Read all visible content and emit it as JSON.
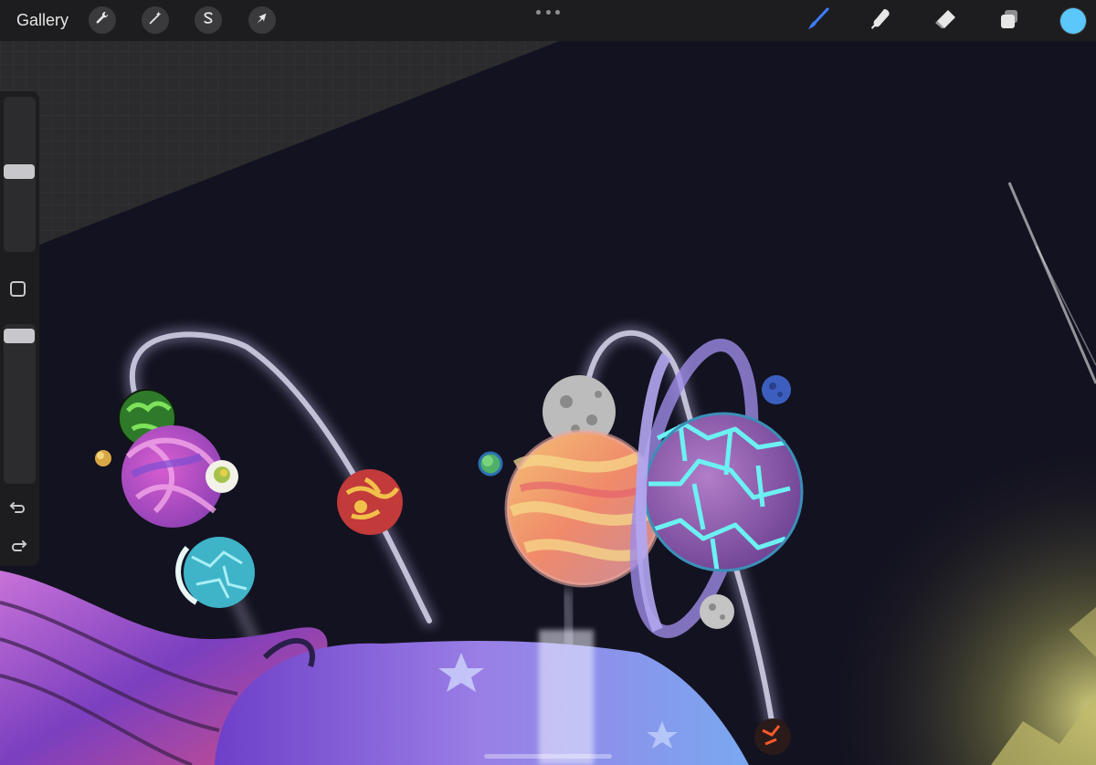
{
  "toolbar": {
    "gallery_label": "Gallery",
    "left_tools": [
      "wrench-icon",
      "magic-wand-icon",
      "selection-s-icon",
      "transform-arrow-icon"
    ],
    "right_tools": [
      "brush-icon",
      "smudge-icon",
      "eraser-icon",
      "layers-icon"
    ],
    "active_tool": "brush",
    "active_tool_color": "#3d7eff",
    "current_color": "#5ac8fa"
  },
  "sidebar": {
    "brush_size_level": 0.45,
    "opacity_level": 1.0,
    "icons": [
      "modify-square-icon",
      "undo-icon",
      "redo-icon"
    ]
  },
  "colors": {
    "canvas_background": "#131220",
    "toolbar_background": "#1d1d1f"
  }
}
